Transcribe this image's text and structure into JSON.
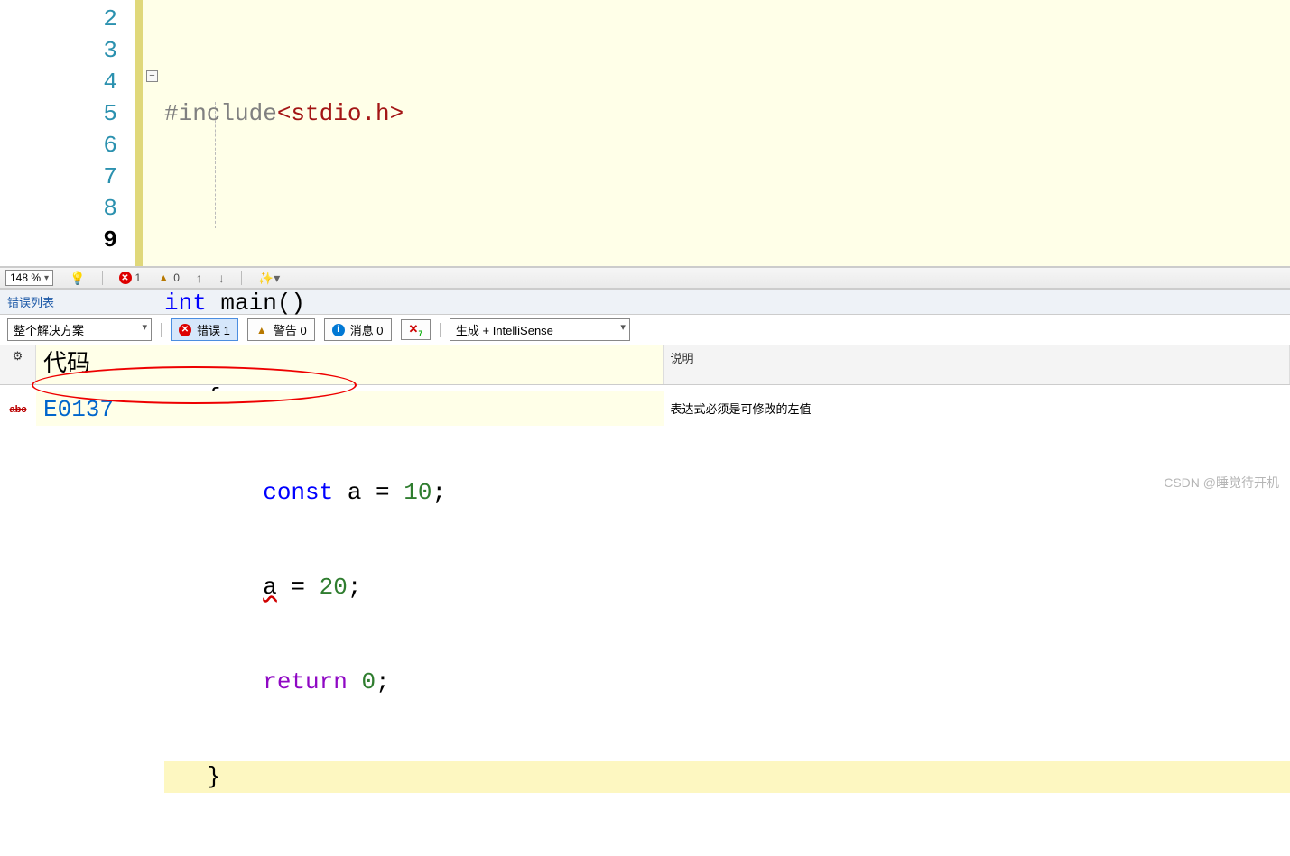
{
  "editor": {
    "line_numbers": [
      "2",
      "3",
      "4",
      "5",
      "6",
      "7",
      "8",
      "9"
    ],
    "code": {
      "l2_pp": "#include",
      "l2_hdr": "<stdio.h>",
      "l3": "",
      "l4_kw": "int",
      "l4_fn": " main()",
      "l5": "{",
      "l6_kw": "const",
      "l6_rest_a": " a = ",
      "l6_num": "10",
      "l6_semi": ";",
      "l7_a": "a",
      "l7_rest": " = ",
      "l7_num": "20",
      "l7_semi": ";",
      "l8_kw": "return",
      "l8_sp": " ",
      "l8_num": "0",
      "l8_semi": ";",
      "l9": "}"
    },
    "fold_glyph": "−"
  },
  "status": {
    "zoom": "148 %",
    "errors": "1",
    "warnings": "0",
    "wand_tip": ""
  },
  "panel": {
    "title": "错误列表",
    "scope_option": "整个解决方案",
    "btn_error": "错误 1",
    "btn_warning": "警告 0",
    "btn_message": "消息 0",
    "build_option": "生成 + IntelliSense",
    "headers": {
      "config": "⚙",
      "code": "代码",
      "desc": "说明"
    },
    "row": {
      "icon_label": "abc",
      "code": "E0137",
      "desc": "表达式必须是可修改的左值"
    }
  },
  "watermark": "CSDN @睡觉待开机"
}
